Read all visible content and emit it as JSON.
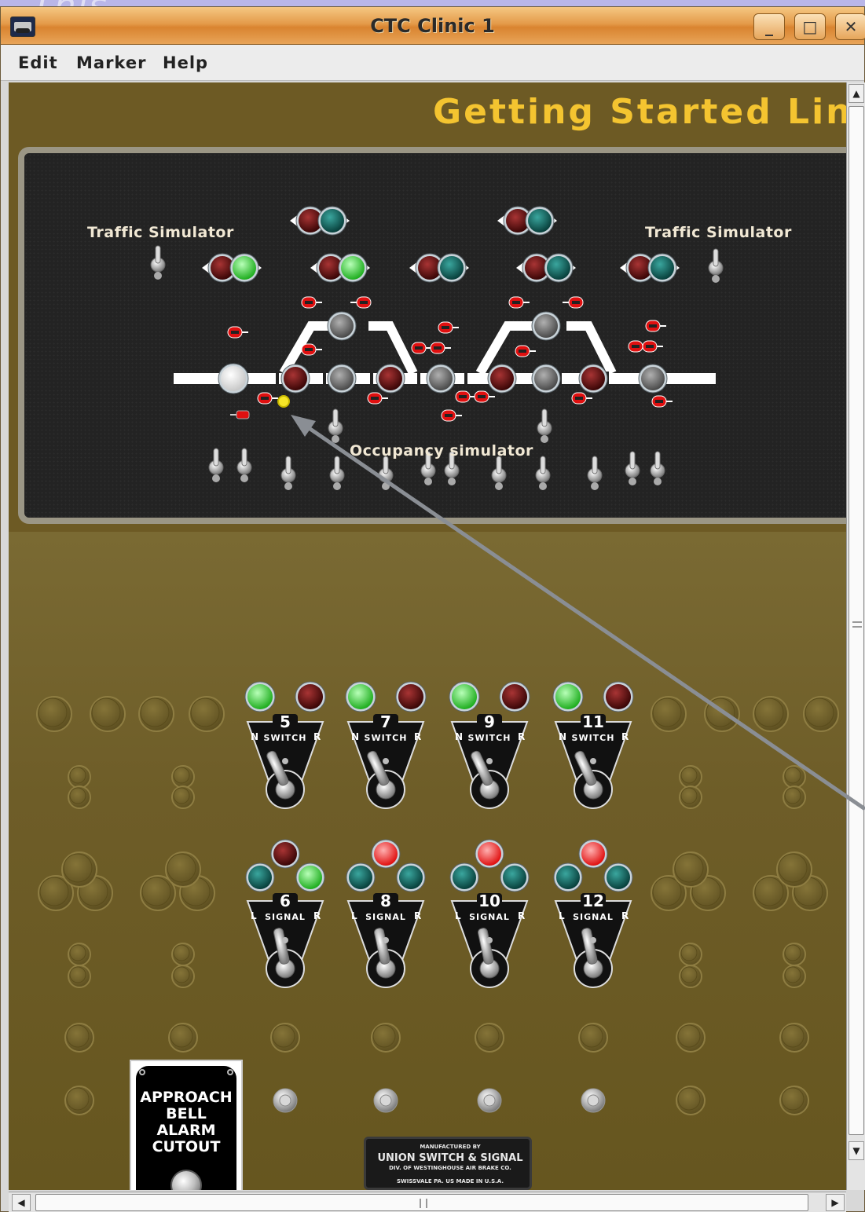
{
  "window": {
    "title": "CTC Clinic 1",
    "background_fragment": "This",
    "controls": {
      "minimize": "_",
      "maximize": "□",
      "close": "✕"
    }
  },
  "menu": {
    "items": [
      "Edit",
      "Marker",
      "Help"
    ]
  },
  "panel": {
    "title": "Getting Started Lines",
    "labels": {
      "traffic_left": "Traffic Simulator",
      "traffic_right": "Traffic Simulator",
      "occupancy": "Occupancy simulator"
    }
  },
  "switch_levers": [
    {
      "number": "5",
      "plate": "SWITCH",
      "left": "N",
      "right": "R",
      "normal_lamp": "green",
      "reverse_lamp": "dark-red"
    },
    {
      "number": "7",
      "plate": "SWITCH",
      "left": "N",
      "right": "R",
      "normal_lamp": "green",
      "reverse_lamp": "dark-red"
    },
    {
      "number": "9",
      "plate": "SWITCH",
      "left": "N",
      "right": "R",
      "normal_lamp": "green",
      "reverse_lamp": "dark-red"
    },
    {
      "number": "11",
      "plate": "SWITCH",
      "left": "N",
      "right": "R",
      "normal_lamp": "green",
      "reverse_lamp": "dark-red"
    }
  ],
  "signal_levers": [
    {
      "number": "6",
      "plate": "SIGNAL",
      "left": "L",
      "right": "R",
      "top_lamp": "dark-red",
      "left_lamp": "teal",
      "right_lamp": "green"
    },
    {
      "number": "8",
      "plate": "SIGNAL",
      "left": "L",
      "right": "R",
      "top_lamp": "red",
      "left_lamp": "teal",
      "right_lamp": "teal"
    },
    {
      "number": "10",
      "plate": "SIGNAL",
      "left": "L",
      "right": "R",
      "top_lamp": "red",
      "left_lamp": "teal",
      "right_lamp": "teal"
    },
    {
      "number": "12",
      "plate": "SIGNAL",
      "left": "L",
      "right": "R",
      "top_lamp": "red",
      "left_lamp": "teal",
      "right_lamp": "teal"
    }
  ],
  "alarm_plate": {
    "text": "APPROACH\nBELL\nALARM\nCUTOUT"
  },
  "maker_plate": {
    "line1": "MANUFACTURED BY",
    "line2": "UNION SWITCH & SIGNAL",
    "line3": "DIV. OF WESTINGHOUSE AIR BRAKE CO.",
    "line4": "SWISSVALE PA.  US  MADE IN U.S.A."
  },
  "colors": {
    "titlebar": "#e49b4a",
    "panel_title": "#f4c430",
    "track_bg": "#232323",
    "brass": "#6e5d28",
    "lamp_green": "#3ee23e",
    "lamp_red": "#ff2a2a",
    "lamp_dark_red": "#5a0a0a",
    "lamp_teal": "#0e5a55",
    "occupancy_yellow": "#f5e628"
  },
  "icons": [
    "app-icon",
    "toggle-switch-icon",
    "arrow-left-icon",
    "arrow-right-icon",
    "scroll-up-icon",
    "scroll-down-icon"
  ]
}
